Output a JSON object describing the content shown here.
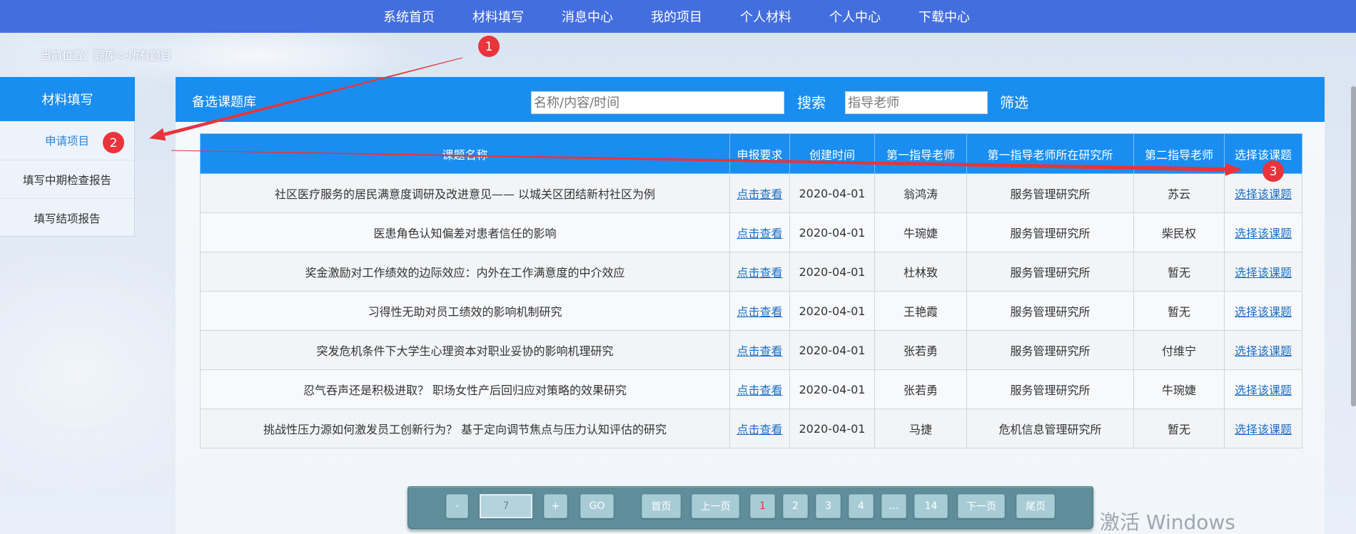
{
  "nav": {
    "items": [
      "系统首页",
      "材料填写",
      "消息中心",
      "我的项目",
      "个人材料",
      "个人中心",
      "下载中心"
    ]
  },
  "breadcrumb": "当前位置：题库->所有题目",
  "sidebar": {
    "title": "材料填写",
    "items": [
      "申请项目",
      "填写中期检查报告",
      "填写结项报告"
    ],
    "active_index": 0
  },
  "panel": {
    "title": "备选课题库",
    "search": {
      "placeholder": "名称/内容/时间",
      "value": "",
      "button": "搜索"
    },
    "filter": {
      "placeholder": "指导老师",
      "value": "",
      "button": "筛选"
    }
  },
  "table": {
    "columns": [
      "课题名称",
      "申报要求",
      "创建时间",
      "第一指导老师",
      "第一指导老师所在研究所",
      "第二指导老师",
      "选择该课题"
    ],
    "rows": [
      {
        "title": "社区医疗服务的居民满意度调研及改进意见—— 以城关区团结新村社区为例",
        "requirement": "点击查看",
        "created": "2020-04-01",
        "advisor1": "翁鸿涛",
        "institute": "服务管理研究所",
        "advisor2": "苏云",
        "action": "选择该课题"
      },
      {
        "title": "医患角色认知偏差对患者信任的影响",
        "requirement": "点击查看",
        "created": "2020-04-01",
        "advisor1": "牛琬婕",
        "institute": "服务管理研究所",
        "advisor2": "柴民权",
        "action": "选择该课题"
      },
      {
        "title": "奖金激励对工作绩效的边际效应：内外在工作满意度的中介效应",
        "requirement": "点击查看",
        "created": "2020-04-01",
        "advisor1": "杜林致",
        "institute": "服务管理研究所",
        "advisor2": "暂无",
        "action": "选择该课题"
      },
      {
        "title": "习得性无助对员工绩效的影响机制研究",
        "requirement": "点击查看",
        "created": "2020-04-01",
        "advisor1": "王艳霞",
        "institute": "服务管理研究所",
        "advisor2": "暂无",
        "action": "选择该课题"
      },
      {
        "title": "突发危机条件下大学生心理资本对职业妥协的影响机理研究",
        "requirement": "点击查看",
        "created": "2020-04-01",
        "advisor1": "张若勇",
        "institute": "服务管理研究所",
        "advisor2": "付维宁",
        "action": "选择该课题"
      },
      {
        "title": "忍气吞声还是积极进取？ 职场女性产后回归应对策略的效果研究",
        "requirement": "点击查看",
        "created": "2020-04-01",
        "advisor1": "张若勇",
        "institute": "服务管理研究所",
        "advisor2": "牛琬婕",
        "action": "选择该课题"
      },
      {
        "title": "挑战性压力源如何激发员工创新行为？ 基于定向调节焦点与压力认知评估的研究",
        "requirement": "点击查看",
        "created": "2020-04-01",
        "advisor1": "马捷",
        "institute": "危机信息管理研究所",
        "advisor2": "暂无",
        "action": "选择该课题"
      }
    ]
  },
  "pagination": {
    "decrement": "-",
    "page_input": "7",
    "increment": "+",
    "go": "GO",
    "first": "首页",
    "prev": "上一页",
    "pages": [
      "1",
      "2",
      "3",
      "4",
      "...",
      "14"
    ],
    "current_index": 0,
    "next": "下一页",
    "last": "尾页"
  },
  "annotations": [
    "1",
    "2",
    "3"
  ],
  "watermark": "激活 Windows",
  "colors": {
    "nav_bg": "#436ee0",
    "accent": "#1a8ef0",
    "link": "#1c6fc4",
    "active_menu": "#2d86d8",
    "annotation": "#e8343a",
    "current_page": "#e53935"
  }
}
